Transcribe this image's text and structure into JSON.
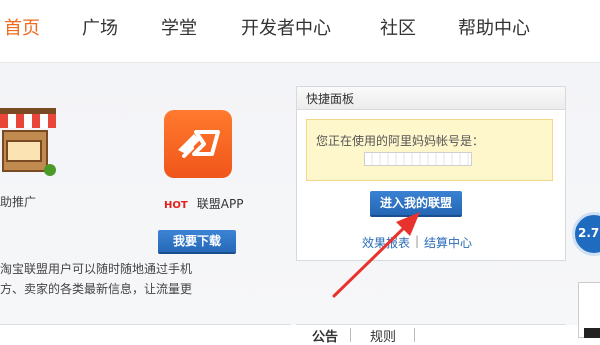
{
  "nav": {
    "items": [
      {
        "label": "首页",
        "active": true
      },
      {
        "label": "广场",
        "active": false
      },
      {
        "label": "学堂",
        "active": false
      },
      {
        "label": "开发者中心",
        "active": false
      },
      {
        "label": "社区",
        "active": false
      },
      {
        "label": "帮助中心",
        "active": false
      }
    ]
  },
  "promo": {
    "shop_label": "助推广",
    "app_hot_badge": "HOT",
    "app_label": "联盟APP",
    "download_button": "我要下载",
    "desc_line1": "淘宝联盟用户可以随时随地通过手机",
    "desc_line2": "方、卖家的各类最新信息，让流量更"
  },
  "quick_panel": {
    "title": "快捷面板",
    "notice_text": "您正在使用的阿里妈妈帐号是：",
    "enter_button": "进入我的联盟",
    "links": [
      "效果报表",
      "结算中心"
    ],
    "link_separator": "|"
  },
  "floating": {
    "value": "2.7"
  },
  "bottom": {
    "tabs": [
      "公告",
      "规则"
    ]
  },
  "colors": {
    "accent_orange": "#f16b1e",
    "button_blue": "#2b6cb6",
    "notice_yellow": "#fff7cc",
    "arrow_red": "#e8322d"
  }
}
